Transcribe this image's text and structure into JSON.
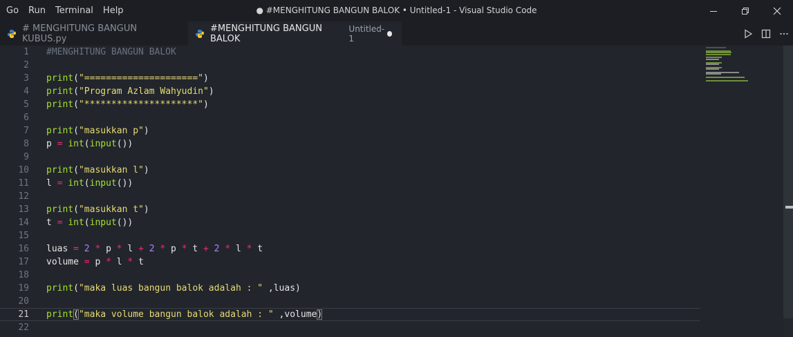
{
  "menu": [
    "Go",
    "Run",
    "Terminal",
    "Help"
  ],
  "window_title": "● #MENGHITUNG BANGUN BALOK • Untitled-1 - Visual Studio Code",
  "tabs": [
    {
      "label": "# MENGHITUNG BANGUN KUBUS.py",
      "sub": "",
      "active": false
    },
    {
      "label": "#MENGHITUNG BANGUN BALOK",
      "sub": "Untitled-1",
      "active": true
    }
  ],
  "editor": {
    "current_line": 21,
    "lines": [
      {
        "n": "1",
        "tokens": [
          {
            "t": "#MENGHITUNG BANGUN BALOK",
            "c": "cm"
          }
        ]
      },
      {
        "n": "2",
        "tokens": []
      },
      {
        "n": "3",
        "tokens": [
          {
            "t": "print",
            "c": "fn"
          },
          {
            "t": "(",
            "c": "txt"
          },
          {
            "t": "\"=====================\"",
            "c": "str"
          },
          {
            "t": ")",
            "c": "txt"
          }
        ]
      },
      {
        "n": "4",
        "tokens": [
          {
            "t": "print",
            "c": "fn"
          },
          {
            "t": "(",
            "c": "txt"
          },
          {
            "t": "\"Program Azlam Wahyudin\"",
            "c": "str"
          },
          {
            "t": ")",
            "c": "txt"
          }
        ]
      },
      {
        "n": "5",
        "tokens": [
          {
            "t": "print",
            "c": "fn"
          },
          {
            "t": "(",
            "c": "txt"
          },
          {
            "t": "\"*********************\"",
            "c": "str"
          },
          {
            "t": ")",
            "c": "txt"
          }
        ]
      },
      {
        "n": "6",
        "tokens": []
      },
      {
        "n": "7",
        "tokens": [
          {
            "t": "print",
            "c": "fn"
          },
          {
            "t": "(",
            "c": "txt"
          },
          {
            "t": "\"masukkan p\"",
            "c": "str"
          },
          {
            "t": ")",
            "c": "txt"
          }
        ]
      },
      {
        "n": "8",
        "tokens": [
          {
            "t": "p ",
            "c": "txt"
          },
          {
            "t": "=",
            "c": "op"
          },
          {
            "t": " ",
            "c": "txt"
          },
          {
            "t": "int",
            "c": "fn"
          },
          {
            "t": "(",
            "c": "txt"
          },
          {
            "t": "input",
            "c": "fn"
          },
          {
            "t": "())",
            "c": "txt"
          }
        ]
      },
      {
        "n": "9",
        "tokens": []
      },
      {
        "n": "10",
        "tokens": [
          {
            "t": "print",
            "c": "fn"
          },
          {
            "t": "(",
            "c": "txt"
          },
          {
            "t": "\"masukkan l\"",
            "c": "str"
          },
          {
            "t": ")",
            "c": "txt"
          }
        ]
      },
      {
        "n": "11",
        "tokens": [
          {
            "t": "l ",
            "c": "txt"
          },
          {
            "t": "=",
            "c": "op"
          },
          {
            "t": " ",
            "c": "txt"
          },
          {
            "t": "int",
            "c": "fn"
          },
          {
            "t": "(",
            "c": "txt"
          },
          {
            "t": "input",
            "c": "fn"
          },
          {
            "t": "())",
            "c": "txt"
          }
        ]
      },
      {
        "n": "12",
        "tokens": []
      },
      {
        "n": "13",
        "tokens": [
          {
            "t": "print",
            "c": "fn"
          },
          {
            "t": "(",
            "c": "txt"
          },
          {
            "t": "\"masukkan t\"",
            "c": "str"
          },
          {
            "t": ")",
            "c": "txt"
          }
        ]
      },
      {
        "n": "14",
        "tokens": [
          {
            "t": "t ",
            "c": "txt"
          },
          {
            "t": "=",
            "c": "op"
          },
          {
            "t": " ",
            "c": "txt"
          },
          {
            "t": "int",
            "c": "fn"
          },
          {
            "t": "(",
            "c": "txt"
          },
          {
            "t": "input",
            "c": "fn"
          },
          {
            "t": "())",
            "c": "txt"
          }
        ]
      },
      {
        "n": "15",
        "tokens": []
      },
      {
        "n": "16",
        "tokens": [
          {
            "t": "luas ",
            "c": "txt"
          },
          {
            "t": "=",
            "c": "op"
          },
          {
            "t": " ",
            "c": "txt"
          },
          {
            "t": "2",
            "c": "num"
          },
          {
            "t": " ",
            "c": "txt"
          },
          {
            "t": "*",
            "c": "op"
          },
          {
            "t": " p ",
            "c": "txt"
          },
          {
            "t": "*",
            "c": "op"
          },
          {
            "t": " l ",
            "c": "txt"
          },
          {
            "t": "+",
            "c": "op"
          },
          {
            "t": " ",
            "c": "txt"
          },
          {
            "t": "2",
            "c": "num"
          },
          {
            "t": " ",
            "c": "txt"
          },
          {
            "t": "*",
            "c": "op"
          },
          {
            "t": " p ",
            "c": "txt"
          },
          {
            "t": "*",
            "c": "op"
          },
          {
            "t": " t ",
            "c": "txt"
          },
          {
            "t": "+",
            "c": "op"
          },
          {
            "t": " ",
            "c": "txt"
          },
          {
            "t": "2",
            "c": "num"
          },
          {
            "t": " ",
            "c": "txt"
          },
          {
            "t": "*",
            "c": "op"
          },
          {
            "t": " l ",
            "c": "txt"
          },
          {
            "t": "*",
            "c": "op"
          },
          {
            "t": " t",
            "c": "txt"
          }
        ]
      },
      {
        "n": "17",
        "tokens": [
          {
            "t": "volume ",
            "c": "txt"
          },
          {
            "t": "=",
            "c": "op"
          },
          {
            "t": " p ",
            "c": "txt"
          },
          {
            "t": "*",
            "c": "op"
          },
          {
            "t": " l ",
            "c": "txt"
          },
          {
            "t": "*",
            "c": "op"
          },
          {
            "t": " t",
            "c": "txt"
          }
        ]
      },
      {
        "n": "18",
        "tokens": []
      },
      {
        "n": "19",
        "tokens": [
          {
            "t": "print",
            "c": "fn"
          },
          {
            "t": "(",
            "c": "txt"
          },
          {
            "t": "\"maka luas bangun balok adalah : \"",
            "c": "str"
          },
          {
            "t": " ,luas)",
            "c": "txt"
          }
        ]
      },
      {
        "n": "20",
        "tokens": []
      },
      {
        "n": "21",
        "tokens": [
          {
            "t": "print",
            "c": "fn"
          },
          {
            "t": "(",
            "c": "txt br"
          },
          {
            "t": "\"maka volume bangun balok adalah : \"",
            "c": "str"
          },
          {
            "t": " ,volume",
            "c": "txt"
          },
          {
            "t": ")",
            "c": "txt br"
          }
        ]
      },
      {
        "n": "22",
        "tokens": []
      }
    ]
  },
  "colors": {
    "background": "#22252c",
    "titlebar": "#1c1e23",
    "comment": "#6b7280",
    "function": "#a6e22e",
    "string": "#e6db74",
    "operator": "#f92672",
    "number": "#ae81ff"
  },
  "icons": [
    "python-file-icon",
    "run-icon",
    "split-editor-icon",
    "more-icon",
    "minimize-icon",
    "restore-icon",
    "close-icon"
  ]
}
